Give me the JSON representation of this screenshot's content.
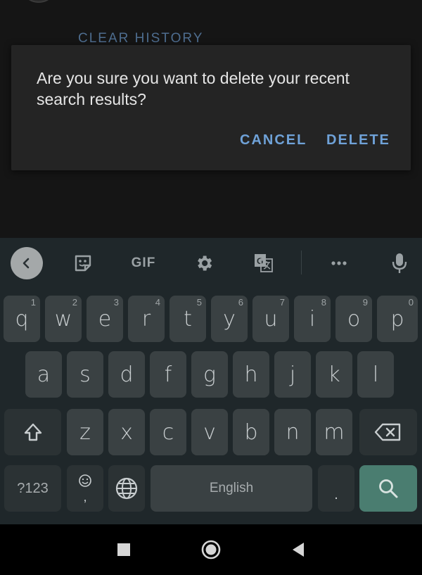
{
  "background": {
    "clear_history_label": "CLEAR HISTORY"
  },
  "dialog": {
    "message": "Are you sure you want to delete your recent search results?",
    "cancel_label": "CANCEL",
    "delete_label": "DELETE"
  },
  "keyboard": {
    "toolbar": {
      "gif_label": "GIF"
    },
    "row1": [
      {
        "key": "q",
        "hint": "1"
      },
      {
        "key": "w",
        "hint": "2"
      },
      {
        "key": "e",
        "hint": "3"
      },
      {
        "key": "r",
        "hint": "4"
      },
      {
        "key": "t",
        "hint": "5"
      },
      {
        "key": "y",
        "hint": "6"
      },
      {
        "key": "u",
        "hint": "7"
      },
      {
        "key": "i",
        "hint": "8"
      },
      {
        "key": "o",
        "hint": "9"
      },
      {
        "key": "p",
        "hint": "0"
      }
    ],
    "row2": [
      "a",
      "s",
      "d",
      "f",
      "g",
      "h",
      "j",
      "k",
      "l"
    ],
    "row3": [
      "z",
      "x",
      "c",
      "v",
      "b",
      "n",
      "m"
    ],
    "symbols_label": "?123",
    "emoji_sub_label": ",",
    "space_label": "English",
    "period_label": "."
  },
  "colors": {
    "dialog_button": "#6fa2d8",
    "search_key": "#4a7d70",
    "key_bg": "#3a4143"
  }
}
